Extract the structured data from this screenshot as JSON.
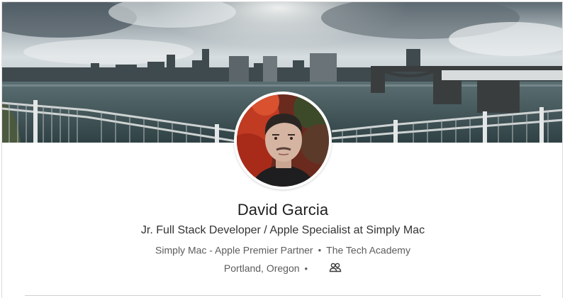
{
  "profile": {
    "name": "David Garcia",
    "headline": "Jr. Full Stack Developer / Apple Specialist at Simply Mac",
    "company_current": "Simply Mac - Apple Premier Partner",
    "company_education": "The Tech Academy",
    "separator": "•",
    "location": "Portland, Oregon"
  },
  "icons": {
    "connections": "people-icon"
  },
  "colors": {
    "name": "#1f1f1f",
    "headline": "#333333",
    "meta": "#5c5c5c",
    "divider": "#cfcfcf"
  }
}
